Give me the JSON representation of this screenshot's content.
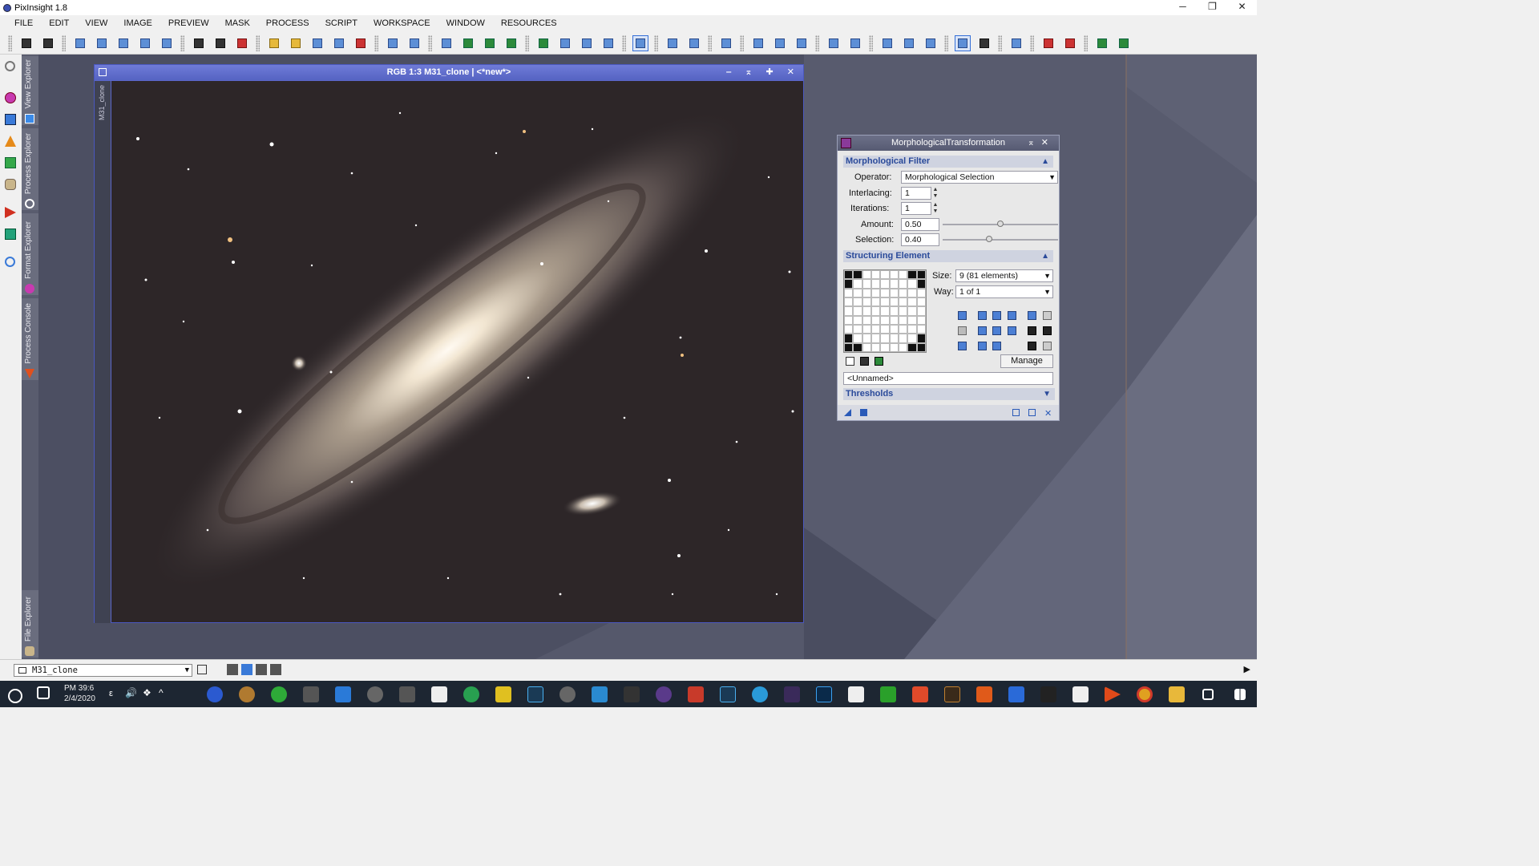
{
  "app": {
    "title": "PixInsight 1.8"
  },
  "window_controls": {
    "minimize": "─",
    "restore": "❐",
    "close": "✕"
  },
  "menu": [
    "FILE",
    "EDIT",
    "VIEW",
    "IMAGE",
    "PREVIEW",
    "MASK",
    "PROCESS",
    "SCRIPT",
    "WORKSPACE",
    "WINDOW",
    "RESOURCES"
  ],
  "left_tabs": {
    "view_explorer": "View Explorer",
    "process_explorer": "Process Explorer",
    "format_explorer": "Format Explorer",
    "process_console": "Process Console",
    "file_explorer": "File Explorer"
  },
  "image_window": {
    "title": "RGB 1:3 M31_clone | <*new*>",
    "side_label": "M31_clone",
    "controls": "‒ ⌅ ✚ ✕"
  },
  "panel": {
    "title": "MorphologicalTransformation",
    "section_filter": "Morphological Filter",
    "operator_label": "Operator:",
    "operator_value": "Morphological Selection",
    "interlacing_label": "Interlacing:",
    "interlacing_value": "1",
    "iterations_label": "Iterations:",
    "iterations_value": "1",
    "amount_label": "Amount:",
    "amount_value": "0.50",
    "amount_level": 0.5,
    "selection_label": "Selection:",
    "selection_value": "0.40",
    "selection_level": 0.4,
    "section_struct": "Structuring Element",
    "size_label": "Size:",
    "size_value": "9  (81 elements)",
    "way_label": "Way:",
    "way_value": "1 of 1",
    "manage_label": "Manage",
    "name_value": "<Unnamed>",
    "section_thresholds": "Thresholds"
  },
  "statusbar": {
    "view_selector": "M31_clone"
  },
  "taskbar": {
    "time": "PM 39:6",
    "date": "2/4/2020"
  },
  "colors": {
    "accent": "#5563c2",
    "workspace": "#4c4f62",
    "section_text": "#2a4a9a"
  }
}
